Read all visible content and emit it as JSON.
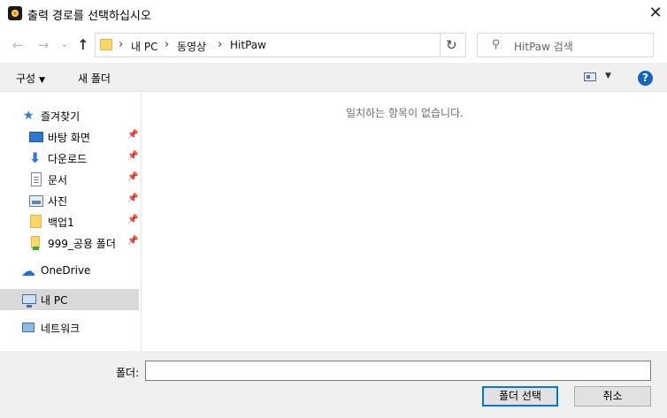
{
  "window": {
    "title": "출력 경로를 선택하십시오",
    "close_glyph": "✕"
  },
  "nav": {
    "back_glyph": "←",
    "forward_glyph": "→",
    "recent_glyph": "⌄",
    "up_glyph": "↑",
    "breadcrumb": [
      "내 PC",
      "동영상",
      "HitPaw"
    ],
    "separator": "›",
    "refresh_glyph": "↻",
    "search_placeholder": "HitPaw 검색"
  },
  "toolbar": {
    "organize_label": "구성",
    "organize_caret": "▼",
    "new_folder_label": "새 폴더",
    "view_caret": "▼",
    "help_label": "?"
  },
  "sidebar": {
    "items": [
      {
        "label": "즐겨찾기",
        "icon": "star-icon"
      },
      {
        "label": "바탕 화면",
        "icon": "desktop-icon",
        "pinned": true
      },
      {
        "label": "다운로드",
        "icon": "download-icon",
        "pinned": true
      },
      {
        "label": "문서",
        "icon": "document-icon",
        "pinned": true
      },
      {
        "label": "사진",
        "icon": "pictures-icon",
        "pinned": true
      },
      {
        "label": "백업1",
        "icon": "folder-icon",
        "pinned": true
      },
      {
        "label": "999_공용 폴더",
        "icon": "shared-folder-icon",
        "pinned": true
      },
      {
        "label": "OneDrive",
        "icon": "onedrive-icon"
      },
      {
        "label": "내 PC",
        "icon": "this-pc-icon",
        "selected": true
      },
      {
        "label": "네트워크",
        "icon": "network-icon"
      }
    ],
    "pin_glyph": "📌"
  },
  "content": {
    "empty_message": "일치하는 항목이 없습니다."
  },
  "footer": {
    "folder_label": "폴더:",
    "folder_value": "",
    "select_button": "폴더 선택",
    "cancel_button": "취소"
  }
}
